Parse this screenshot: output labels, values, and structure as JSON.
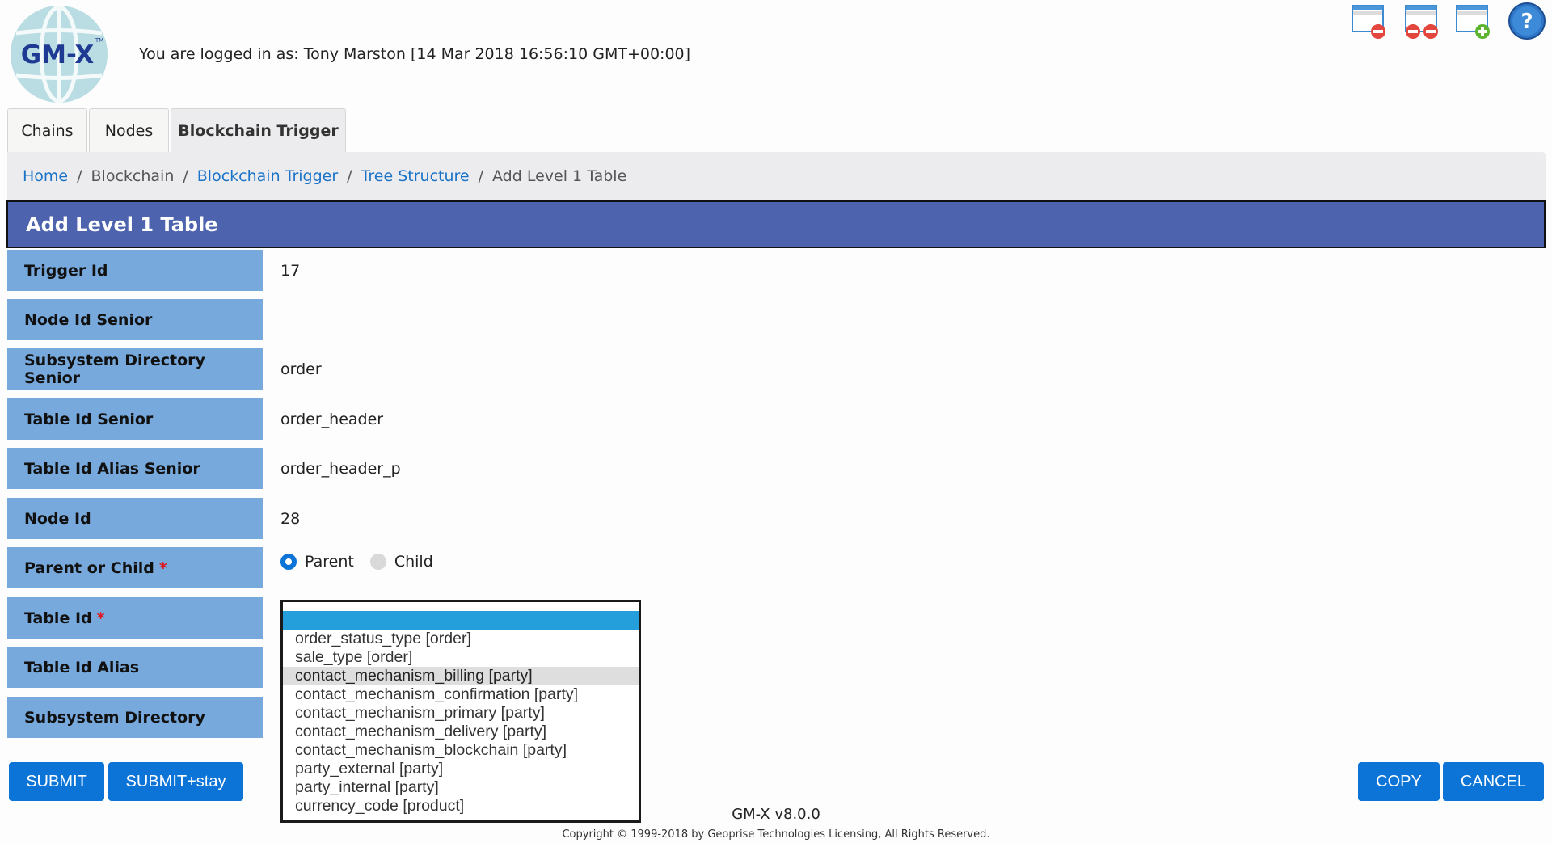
{
  "app": {
    "logo_text": "GM-X",
    "logo_tm": "TM",
    "login_text": "You are logged in as: Tony Marston [14 Mar 2018 16:56:10 GMT+00:00]"
  },
  "header_icons": [
    {
      "name": "remove-screen-icon",
      "title": "Remove"
    },
    {
      "name": "remove-all-screens-icon",
      "title": "Remove all"
    },
    {
      "name": "add-screen-icon",
      "title": "Add"
    },
    {
      "name": "help-icon",
      "title": "Help"
    }
  ],
  "tabs": [
    {
      "label": "Chains",
      "active": false
    },
    {
      "label": "Nodes",
      "active": false
    },
    {
      "label": "Blockchain Trigger",
      "active": true
    }
  ],
  "breadcrumb": [
    {
      "label": "Home",
      "link": true
    },
    {
      "label": "Blockchain",
      "link": false
    },
    {
      "label": "Blockchain Trigger",
      "link": true
    },
    {
      "label": "Tree Structure",
      "link": true
    },
    {
      "label": "Add Level 1 Table",
      "link": false
    }
  ],
  "page_title": "Add Level 1 Table",
  "form": {
    "rows": [
      {
        "label": "Trigger Id",
        "value": "17",
        "required": false
      },
      {
        "label": "Node Id Senior",
        "value": "",
        "required": false
      },
      {
        "label": "Subsystem Directory Senior",
        "value": "order",
        "required": false
      },
      {
        "label": "Table Id Senior",
        "value": "order_header",
        "required": false
      },
      {
        "label": "Table Id Alias Senior",
        "value": "order_header_p",
        "required": false
      },
      {
        "label": "Node Id",
        "value": "28",
        "required": false
      },
      {
        "label": "Parent or Child",
        "value": "",
        "required": true
      },
      {
        "label": "Table Id",
        "value": "",
        "required": true
      },
      {
        "label": "Table Id Alias",
        "value": "",
        "required": false
      },
      {
        "label": "Subsystem Directory",
        "value": "",
        "required": false
      }
    ],
    "required_marker": "*",
    "parent_or_child": {
      "options": [
        "Parent",
        "Child"
      ],
      "selected": "Parent"
    },
    "table_id_options": {
      "selected_index": 0,
      "hover_index": 3,
      "options": [
        "",
        "order_status_type [order]",
        "sale_type [order]",
        "contact_mechanism_billing [party]",
        "contact_mechanism_confirmation [party]",
        "contact_mechanism_primary [party]",
        "contact_mechanism_delivery [party]",
        "contact_mechanism_blockchain [party]",
        "party_external [party]",
        "party_internal [party]",
        "currency_code [product]"
      ]
    }
  },
  "buttons": {
    "submit": "SUBMIT",
    "submit_stay": "SUBMIT+stay",
    "copy": "COPY",
    "cancel": "CANCEL"
  },
  "footer": {
    "version": "GM-X v8.0.0",
    "copyright": "Copyright © 1999-2018 by Geoprise Technologies Licensing, All Rights Reserved."
  },
  "colors": {
    "title_bar": "#4e63ae",
    "label_bg": "#77a9dc",
    "button": "#0b74d6",
    "link": "#1a73c8",
    "required": "#e2131b",
    "list_selected": "#259fdc"
  }
}
